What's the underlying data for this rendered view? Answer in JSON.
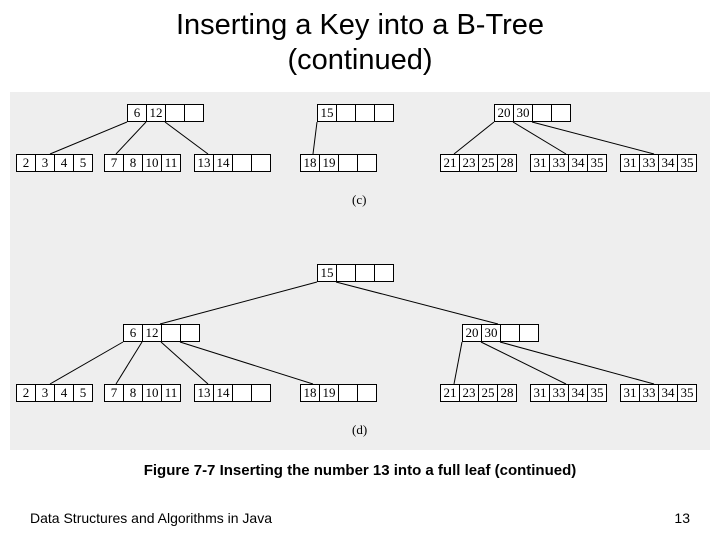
{
  "title_line1": "Inserting a Key into a B-Tree",
  "title_line2": "(continued)",
  "caption": "Figure 7-7 Inserting the number 13 into a full leaf (continued)",
  "footer_left": "Data Structures and Algorithms in Java",
  "footer_right": "13",
  "sub_c": "(c)",
  "sub_d": "(d)",
  "tree_c": {
    "n1": [
      "6",
      "12",
      "",
      ""
    ],
    "n2": [
      "15",
      "",
      "",
      ""
    ],
    "n3": [
      "20",
      "30",
      "",
      ""
    ],
    "l1": [
      "2",
      "3",
      "4",
      "5"
    ],
    "l2": [
      "7",
      "8",
      "10",
      "11"
    ],
    "l3": [
      "13",
      "14",
      "",
      ""
    ],
    "l4": [
      "18",
      "19",
      "",
      ""
    ],
    "l5": [
      "21",
      "23",
      "25",
      "28"
    ],
    "l6": [
      "31",
      "33",
      "34",
      "35"
    ]
  },
  "tree_d": {
    "root": [
      "15",
      "",
      "",
      ""
    ],
    "n1": [
      "6",
      "12",
      "",
      ""
    ],
    "n2": [
      "20",
      "30",
      "",
      ""
    ],
    "l1": [
      "2",
      "3",
      "4",
      "5"
    ],
    "l2": [
      "7",
      "8",
      "10",
      "11"
    ],
    "l3": [
      "13",
      "14",
      "",
      ""
    ],
    "l4": [
      "18",
      "19",
      "",
      ""
    ],
    "l5": [
      "21",
      "23",
      "25",
      "28"
    ],
    "l6": [
      "31",
      "33",
      "34",
      "35"
    ]
  }
}
